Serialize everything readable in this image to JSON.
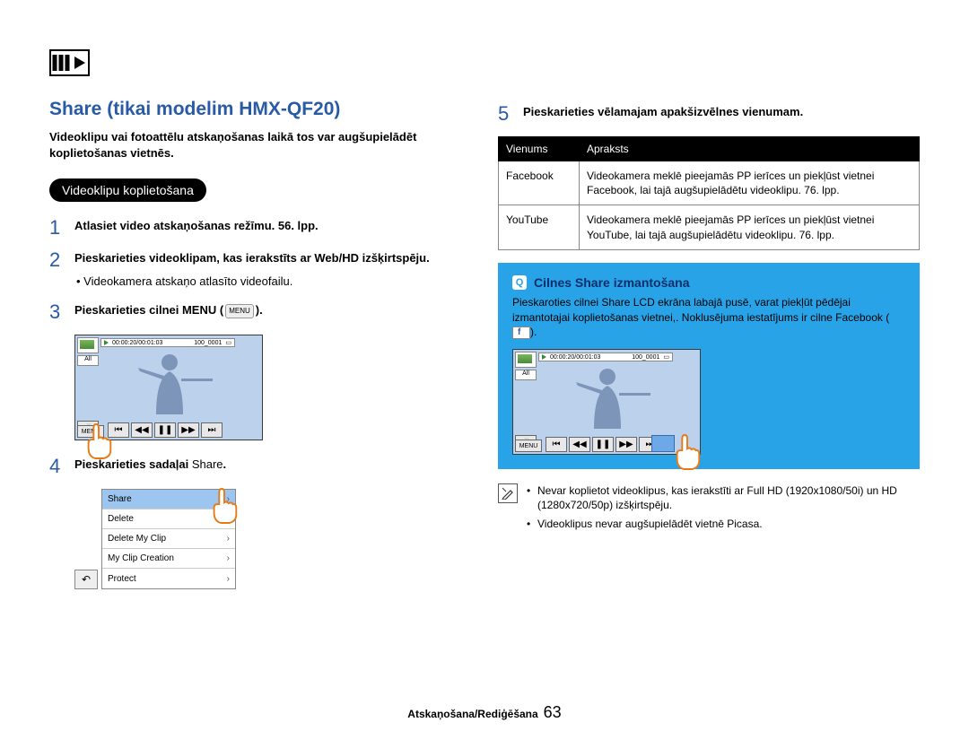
{
  "header": {
    "title": "Share (tikai modelim HMX-QF20)"
  },
  "intro": "Videoklipu vai fotoattēlu atskaņošanas laikā tos var augšupielādēt koplietošanas vietnēs.",
  "section_pill": "Videoklipu koplietošana",
  "steps": {
    "s1": {
      "num": "1",
      "text": "Atlasiet video atskaņošanas režīmu.  56. lpp."
    },
    "s2": {
      "num": "2",
      "text": "Pieskarieties videoklipam, kas ierakstīts ar Web/HD izšķirtspēju.",
      "sub": "Videokamera atskaņo atlasīto videofailu."
    },
    "s3": {
      "num": "3",
      "text_a": "Pieskarieties cilnei MENU (",
      "text_b": ").",
      "menu_label": "MENU"
    },
    "s4": {
      "num": "4",
      "text_a": "Pieskarieties sadaļai ",
      "text_b": "Share",
      "text_c": "."
    },
    "s5": {
      "num": "5",
      "text": "Pieskarieties vēlamajam apakšizvēlnes vienumam."
    }
  },
  "lcd": {
    "tc": "00:00:20/00:01:03",
    "clip": "100_0001",
    "all": "All",
    "menu": "MENU"
  },
  "menu_list": {
    "items": [
      "Share",
      "Delete",
      "Delete My Clip",
      "My Clip Creation",
      "Protect"
    ]
  },
  "table": {
    "h1": "Vienums",
    "h2": "Apraksts",
    "r1c1": "Facebook",
    "r1c2": "Videokamera meklē pieejamās PP ierīces un piekļūst vietnei Facebook, lai tajā augšupielādētu videoklipu.  76. lpp.",
    "r2c1": "YouTube",
    "r2c2": "Videokamera meklē pieejamās PP ierīces un piekļūst vietnei YouTube, lai tajā augšupielādētu videoklipu.  76. lpp."
  },
  "bluebox": {
    "heading": "Cilnes Share izmantošana",
    "body_a": "Pieskaroties cilnei Share LCD ekrāna labajā pusē, varat piekļūt pēdējai izmantotajai koplietošanas vietnei,. Noklusējuma iestatījums ir cilne Facebook (",
    "body_b": ")."
  },
  "notes": {
    "n1": "Nevar koplietot videoklipus, kas ierakstīti ar Full HD (1920x1080/50i) un HD (1280x720/50p) izšķirtspēju.",
    "n2": "Videoklipus nevar augšupielādēt vietnē Picasa."
  },
  "footer": {
    "section": "Atskaņošana/Rediģēšana",
    "page": "63"
  }
}
